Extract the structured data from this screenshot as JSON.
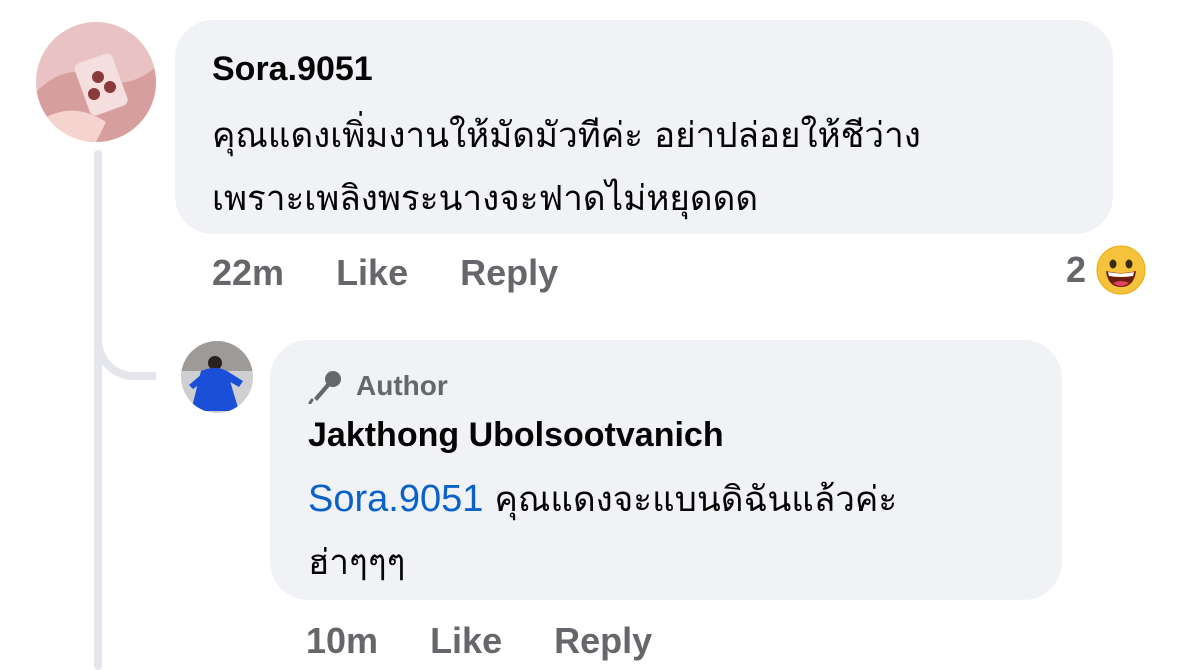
{
  "comment": {
    "author": "Sora.9051",
    "text_line1": "คุณแดงเพิ่มงานให้มัดมัวทีค่ะ อย่าปล่อยให้ชีว่าง",
    "text_line2": "เพราะเพลิงพระนางจะฟาดไม่หยุดดด",
    "time": "22m",
    "like_label": "Like",
    "reply_label": "Reply",
    "reaction_count": "2",
    "reaction_icon": "grinning-face-emoji"
  },
  "reply": {
    "badge_icon": "microphone-icon",
    "badge_label": "Author",
    "author": "Jakthong Ubolsootvanich",
    "mention": "Sora.9051",
    "text_after_mention": " คุณแดงจะแบนดิฉันแล้วค่ะ",
    "text_line2": "ฮ่าๆๆๆ",
    "time": "10m",
    "like_label": "Like",
    "reply_label": "Reply"
  },
  "colors": {
    "bubble": "#f0f2f5",
    "secondary_text": "#65676b",
    "mention": "#0a62c9",
    "thread_line": "#e4e6eb"
  }
}
